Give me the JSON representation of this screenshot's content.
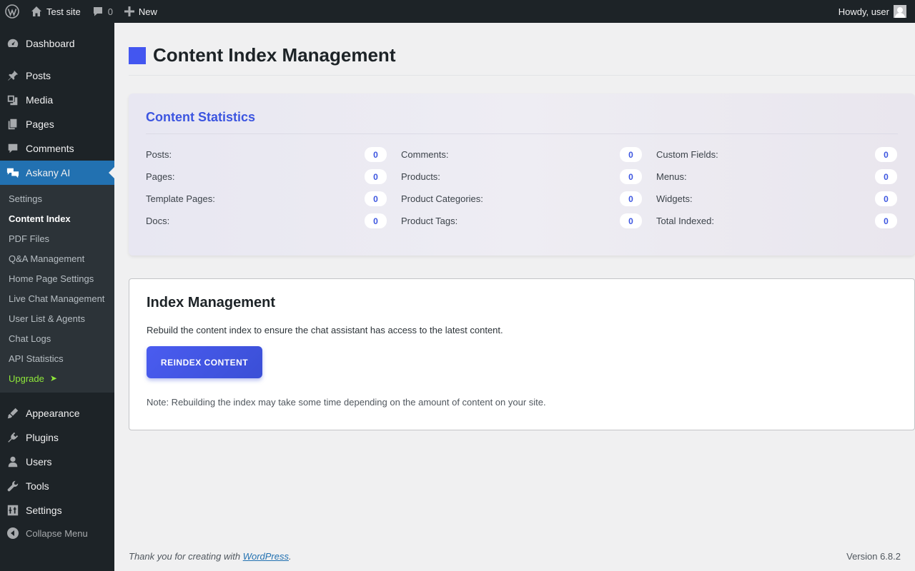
{
  "adminbar": {
    "site_name": "Test site",
    "comments_count": "0",
    "new_label": "New",
    "howdy": "Howdy, user"
  },
  "sidebar": {
    "items_top": [
      {
        "label": "Dashboard",
        "icon": "dashboard-icon"
      },
      {
        "label": "Posts",
        "icon": "pin-icon"
      },
      {
        "label": "Media",
        "icon": "media-icon"
      },
      {
        "label": "Pages",
        "icon": "pages-icon"
      },
      {
        "label": "Comments",
        "icon": "comment-icon"
      },
      {
        "label": "Askany AI",
        "icon": "chat-bubbles-icon"
      }
    ],
    "submenu": [
      {
        "label": "Settings"
      },
      {
        "label": "Content Index"
      },
      {
        "label": "PDF Files"
      },
      {
        "label": "Q&A Management"
      },
      {
        "label": "Home Page Settings"
      },
      {
        "label": "Live Chat Management"
      },
      {
        "label": "User List & Agents"
      },
      {
        "label": "Chat Logs"
      },
      {
        "label": "API Statistics"
      },
      {
        "label": "Upgrade",
        "arrow": "➤"
      }
    ],
    "items_bottom": [
      {
        "label": "Appearance",
        "icon": "brush-icon"
      },
      {
        "label": "Plugins",
        "icon": "plugin-icon"
      },
      {
        "label": "Users",
        "icon": "user-icon"
      },
      {
        "label": "Tools",
        "icon": "wrench-icon"
      },
      {
        "label": "Settings",
        "icon": "settings-sliders-icon"
      }
    ],
    "collapse_label": "Collapse Menu"
  },
  "page": {
    "title": "Content Index Management",
    "accent_color": "#4356f0"
  },
  "stats": {
    "title": "Content Statistics",
    "columns": [
      [
        {
          "label": "Posts:",
          "value": "0"
        },
        {
          "label": "Pages:",
          "value": "0"
        },
        {
          "label": "Template Pages:",
          "value": "0"
        },
        {
          "label": "Docs:",
          "value": "0"
        }
      ],
      [
        {
          "label": "Comments:",
          "value": "0"
        },
        {
          "label": "Products:",
          "value": "0"
        },
        {
          "label": "Product Categories:",
          "value": "0"
        },
        {
          "label": "Product Tags:",
          "value": "0"
        }
      ],
      [
        {
          "label": "Custom Fields:",
          "value": "0"
        },
        {
          "label": "Menus:",
          "value": "0"
        },
        {
          "label": "Widgets:",
          "value": "0"
        },
        {
          "label": "Total Indexed:",
          "value": "0"
        }
      ]
    ]
  },
  "index": {
    "title": "Index Management",
    "description": "Rebuild the content index to ensure the chat assistant has access to the latest content.",
    "button_label": "REINDEX CONTENT",
    "note": "Note: Rebuilding the index may take some time depending on the amount of content on your site."
  },
  "footer": {
    "thanks_prefix": "Thank you for creating with ",
    "link_text": "WordPress",
    "thanks_suffix": ".",
    "version": "Version 6.8.2"
  }
}
